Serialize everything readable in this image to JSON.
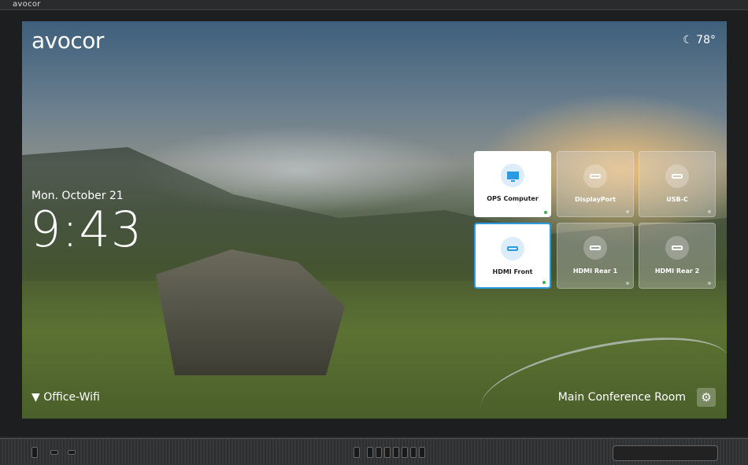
{
  "bezel": {
    "logo": "avocor"
  },
  "screen": {
    "logo": "avocor",
    "weather": {
      "icon": "moon-icon",
      "temperature": "78°"
    },
    "date": "Mon. October 21",
    "time": "9:43",
    "network": {
      "icon": "wifi-icon",
      "name": "Office-Wifi"
    },
    "room": "Main Conference Room",
    "settings_icon": "gear-icon"
  },
  "sources": [
    {
      "label": "OPS Computer",
      "icon": "monitor-icon",
      "state": "selected",
      "signal": true
    },
    {
      "label": "DisplayPort",
      "icon": "port-icon",
      "state": "idle",
      "signal": false
    },
    {
      "label": "USB-C",
      "icon": "port-icon",
      "state": "idle",
      "signal": false
    },
    {
      "label": "HDMI Front",
      "icon": "hdmi-icon",
      "state": "active",
      "signal": true
    },
    {
      "label": "HDMI Rear 1",
      "icon": "hdmi-icon",
      "state": "idle",
      "signal": false
    },
    {
      "label": "HDMI Rear 2",
      "icon": "hdmi-icon",
      "state": "idle",
      "signal": false
    }
  ],
  "colors": {
    "accent": "#2a9be0",
    "signal_on": "#38b549"
  }
}
